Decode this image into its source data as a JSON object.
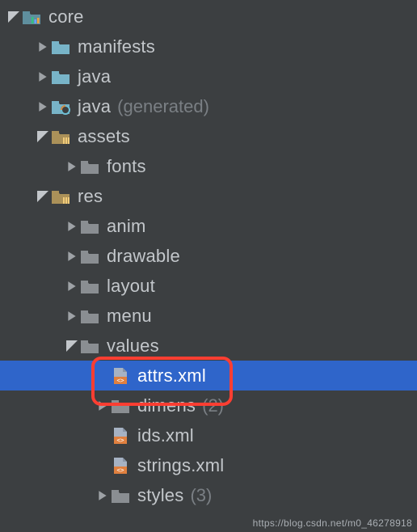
{
  "tree": {
    "core": {
      "label": "core"
    },
    "manifests": {
      "label": "manifests"
    },
    "java": {
      "label": "java"
    },
    "java_gen": {
      "label": "java",
      "suffix": "(generated)"
    },
    "assets": {
      "label": "assets"
    },
    "fonts": {
      "label": "fonts"
    },
    "res": {
      "label": "res"
    },
    "anim": {
      "label": "anim"
    },
    "drawable": {
      "label": "drawable"
    },
    "layout": {
      "label": "layout"
    },
    "menu": {
      "label": "menu"
    },
    "values": {
      "label": "values"
    },
    "attrs": {
      "label": "attrs.xml"
    },
    "dimens": {
      "label": "dimens",
      "count": "(2)"
    },
    "ids": {
      "label": "ids.xml"
    },
    "strings": {
      "label": "strings.xml"
    },
    "styles": {
      "label": "styles",
      "count": "(3)"
    }
  },
  "watermark": "https://blog.csdn.net/m0_46278918"
}
